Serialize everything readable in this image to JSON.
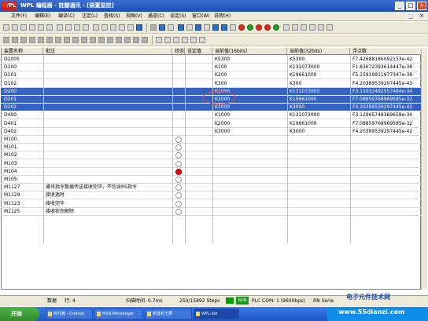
{
  "window": {
    "logo": "WPL",
    "title": "WPL 编程器 - 註腳通讯 - [装置监控]"
  },
  "menu": [
    "文件(F)",
    "编辑(E)",
    "编译(C)",
    "注定(L)",
    "查找(S)",
    "视图(V)",
    "通道(C)",
    "设定(S)",
    "窗口(W)",
    "说明(H)"
  ],
  "table": {
    "headers": [
      "装置名称",
      "批注",
      "状态",
      "设定值",
      "当前值(16bits)",
      "当前值(32bits)",
      "浮点数"
    ],
    "rows": [
      {
        "name": "D1005",
        "comment": "",
        "v16": "K5300",
        "v32": "K5300",
        "float": "F7.42688186092153e-42",
        "selected": false
      },
      {
        "name": "D100",
        "comment": "",
        "v16": "K100",
        "v32": "K131073000",
        "float": "F1.83672393614447e-38",
        "selected": false
      },
      {
        "name": "D101",
        "comment": "",
        "v16": "K200",
        "v32": "K19661000",
        "float": "F5.15919911977347e-38",
        "selected": false
      },
      {
        "name": "D102",
        "comment": "",
        "v16": "K300",
        "v32": "K300",
        "float": "F4.20389539297445e-43",
        "selected": false
      },
      {
        "name": "D200",
        "comment": "",
        "v16": "K1000",
        "v32": "K131073000",
        "float": "F3.15032492557464e-34",
        "selected": true
      },
      {
        "name": "D201",
        "comment": "",
        "v16": "K2000",
        "v32": "K19661000",
        "float": "F7.08859768969585e-32",
        "selected": true
      },
      {
        "name": "D202",
        "comment": "",
        "v16": "K3000",
        "v32": "K3000",
        "float": "F4.20389539297445e-42",
        "selected": true
      },
      {
        "name": "D400",
        "comment": "",
        "v16": "K1000",
        "v32": "K131073000",
        "float": "F3.12965748369658e-34",
        "selected": false
      },
      {
        "name": "D401",
        "comment": "",
        "v16": "K2000",
        "v32": "K19661000",
        "float": "F7.08859768969585e-32",
        "selected": false
      },
      {
        "name": "D402",
        "comment": "",
        "v16": "K3000",
        "v32": "K3000",
        "float": "F4.20389539297445e-42",
        "selected": false
      },
      {
        "name": "M100",
        "comment": "",
        "lamp": "off"
      },
      {
        "name": "M101",
        "comment": "",
        "lamp": "off"
      },
      {
        "name": "M102",
        "comment": "",
        "lamp": "off"
      },
      {
        "name": "M103",
        "comment": "",
        "lamp": "off"
      },
      {
        "name": "M104",
        "comment": "",
        "lamp": "on"
      },
      {
        "name": "M105",
        "comment": "",
        "lamp": "off"
      },
      {
        "name": "M1127",
        "comment": "通讯指令数据传送接收完毕，不包含RS指令",
        "lamp": "off"
      },
      {
        "name": "M1129",
        "comment": "接收逾时",
        "lamp": "off"
      },
      {
        "name": "M1123",
        "comment": "接收完毕",
        "lamp": "off"
      },
      {
        "name": "M1125",
        "comment": "接收状态解除",
        "lamp": "off"
      }
    ]
  },
  "status": {
    "count_label": "数据",
    "rows_label": "行: 4",
    "scan_time": "扫描时间: 0.7ms",
    "steps": "250/15892 Steps",
    "run": "RUN",
    "plc_com": "PLC COM: 1 (9600bps)",
    "mode": "RN Serie"
  },
  "taskbar": {
    "start": "开始",
    "tasks": [
      "收件箱 - Outlook",
      "MSN Messenger",
      "新建名王要",
      "WPL-Ser"
    ],
    "watermark_top": "电子元件技术网",
    "watermark_url": "www.55dianzi.com"
  },
  "colors": {
    "titlebar": "#1f4fb4",
    "selection": "#3561c0",
    "lamp_on": "#e01010",
    "taskbar": "#1f55c8"
  }
}
